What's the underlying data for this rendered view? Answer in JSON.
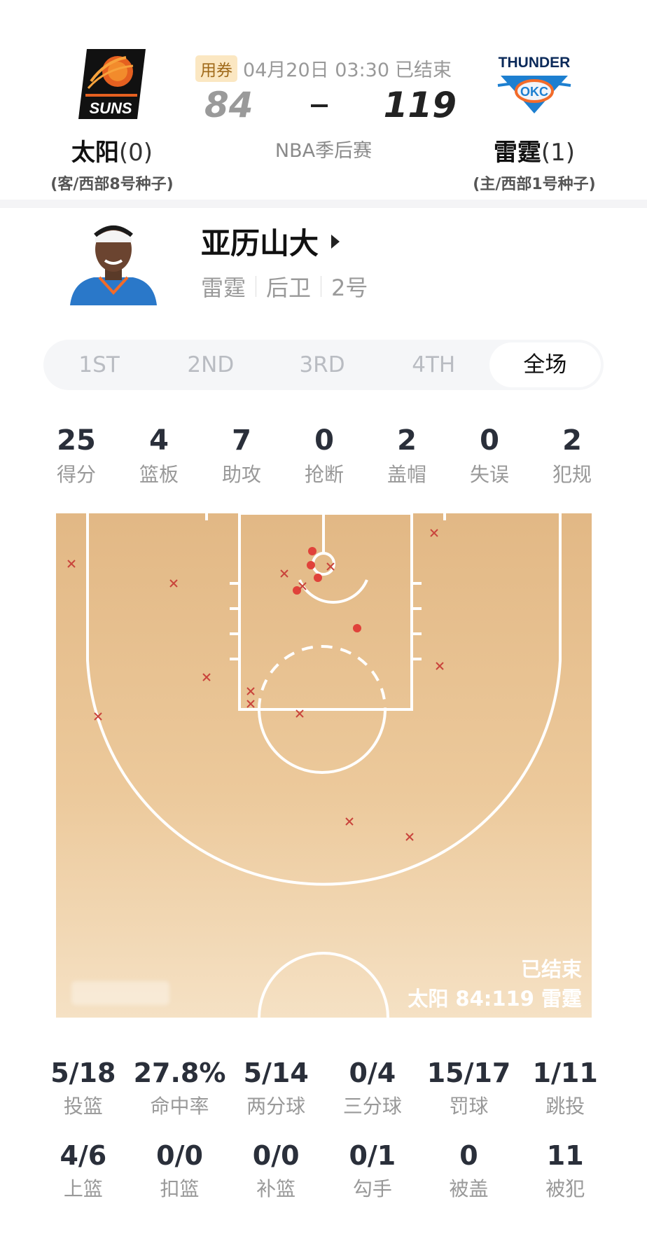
{
  "match": {
    "coupon": "用券",
    "datetime": "04月20日 03:30",
    "status": "已结束",
    "stage": "NBA季后赛",
    "away": {
      "name": "太阳",
      "series_wins": "(0)",
      "seed": "(客/西部8号种子)",
      "score": "84",
      "logo": "suns-logo"
    },
    "home": {
      "name": "雷霆",
      "series_wins": "(1)",
      "seed": "(主/西部1号种子)",
      "score": "119",
      "logo": "thunder-logo"
    }
  },
  "player": {
    "name": "亚历山大",
    "team": "雷霆",
    "position": "后卫",
    "number": "2号"
  },
  "tabs": [
    {
      "label": "1ST",
      "active": false
    },
    {
      "label": "2ND",
      "active": false
    },
    {
      "label": "3RD",
      "active": false
    },
    {
      "label": "4TH",
      "active": false
    },
    {
      "label": "全场",
      "active": true
    }
  ],
  "stats": [
    {
      "value": "25",
      "label": "得分"
    },
    {
      "value": "4",
      "label": "篮板"
    },
    {
      "value": "7",
      "label": "助攻"
    },
    {
      "value": "0",
      "label": "抢断"
    },
    {
      "value": "2",
      "label": "盖帽"
    },
    {
      "value": "0",
      "label": "失误"
    },
    {
      "value": "2",
      "label": "犯规"
    }
  ],
  "court": {
    "status": "已结束",
    "score_line": "太阳 84:119 雷霆",
    "shot_colors": {
      "made": "#e0423a",
      "missed": "#c9443c"
    }
  },
  "shooting": {
    "row1": [
      {
        "value": "5/18",
        "label": "投篮"
      },
      {
        "value": "27.8%",
        "label": "命中率"
      },
      {
        "value": "5/14",
        "label": "两分球"
      },
      {
        "value": "0/4",
        "label": "三分球"
      },
      {
        "value": "15/17",
        "label": "罚球"
      },
      {
        "value": "1/11",
        "label": "跳投"
      }
    ],
    "row2": [
      {
        "value": "4/6",
        "label": "上篮"
      },
      {
        "value": "0/0",
        "label": "扣篮"
      },
      {
        "value": "0/0",
        "label": "补篮"
      },
      {
        "value": "0/1",
        "label": "勾手"
      },
      {
        "value": "0",
        "label": "被盖"
      },
      {
        "value": "11",
        "label": "被犯"
      }
    ]
  }
}
